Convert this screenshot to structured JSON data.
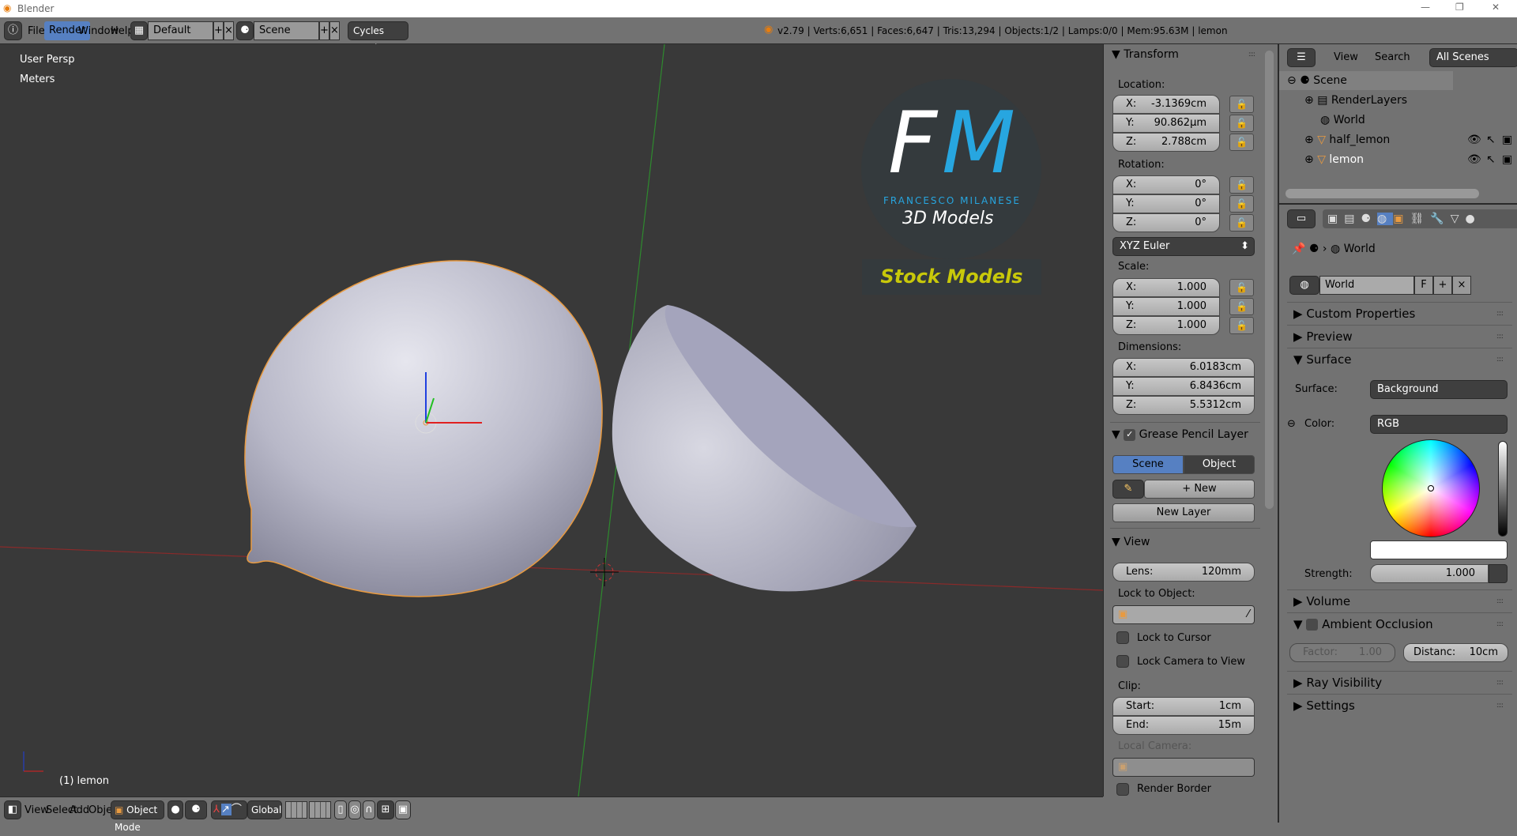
{
  "window": {
    "title": "Blender",
    "min": "—",
    "max": "❐",
    "close": "✕"
  },
  "topbar": {
    "menus": [
      "File",
      "Render",
      "Window",
      "Help"
    ],
    "layout": "Default",
    "scene": "Scene",
    "engine": "Cycles Render",
    "info": "v2.79 | Verts:6,651 | Faces:6,647 | Tris:13,294 | Objects:1/2 | Lamps:0/0 | Mem:95.63M | lemon"
  },
  "viewport": {
    "view_name": "User Persp",
    "units": "Meters",
    "object_label": "(1) lemon",
    "logo": {
      "letters_f": "F",
      "letters_m": "M",
      "brand": "FRANCESCO MILANESE",
      "sub": "3D Models",
      "badge": "Stock Models"
    }
  },
  "npanel": {
    "transform": {
      "title": "Transform",
      "location_label": "Location:",
      "location": [
        {
          "axis": "X:",
          "value": "-3.1369cm"
        },
        {
          "axis": "Y:",
          "value": "90.862µm"
        },
        {
          "axis": "Z:",
          "value": "2.788cm"
        }
      ],
      "rotation_label": "Rotation:",
      "rotation": [
        {
          "axis": "X:",
          "value": "0°"
        },
        {
          "axis": "Y:",
          "value": "0°"
        },
        {
          "axis": "Z:",
          "value": "0°"
        }
      ],
      "rotation_mode": "XYZ Euler",
      "scale_label": "Scale:",
      "scale": [
        {
          "axis": "X:",
          "value": "1.000"
        },
        {
          "axis": "Y:",
          "value": "1.000"
        },
        {
          "axis": "Z:",
          "value": "1.000"
        }
      ],
      "dimensions_label": "Dimensions:",
      "dimensions": [
        {
          "axis": "X:",
          "value": "6.0183cm"
        },
        {
          "axis": "Y:",
          "value": "6.8436cm"
        },
        {
          "axis": "Z:",
          "value": "5.5312cm"
        }
      ]
    },
    "grease": {
      "title": "Grease Pencil Layer",
      "scene": "Scene",
      "object": "Object",
      "new": "New",
      "new_layer": "New Layer"
    },
    "view": {
      "title": "View",
      "lens_label": "Lens:",
      "lens": "120mm",
      "lock_object": "Lock to Object:",
      "lock_cursor": "Lock to Cursor",
      "lock_camera": "Lock Camera to View",
      "clip": "Clip:",
      "start_label": "Start:",
      "start": "1cm",
      "end_label": "End:",
      "end": "15m",
      "local_camera": "Local Camera:",
      "render_border": "Render Border"
    }
  },
  "outliner": {
    "view": "View",
    "search": "Search",
    "filter": "All Scenes",
    "items": [
      "Scene",
      "RenderLayers",
      "World",
      "half_lemon",
      "lemon"
    ]
  },
  "properties": {
    "breadcrumb": "World",
    "world_name": "World",
    "fake_user": "F",
    "sections": {
      "custom": "Custom Properties",
      "preview": "Preview",
      "surface": "Surface",
      "volume": "Volume",
      "ao": "Ambient Occlusion",
      "ray": "Ray Visibility",
      "settings": "Settings"
    },
    "surface_label": "Surface:",
    "surface_value": "Background",
    "color_label": "Color:",
    "color_mode": "RGB",
    "color_value": "#ffffff",
    "strength_label": "Strength:",
    "strength": "1.000",
    "factor_label": "Factor:",
    "factor": "1.00",
    "distance_label": "Distanc:",
    "distance": "10cm"
  },
  "bottombar": {
    "menus": [
      "View",
      "Select",
      "Add",
      "Object"
    ],
    "mode": "Object Mode",
    "orientation": "Global"
  },
  "colors": {
    "accent": "#5680c2",
    "viewport": "#393939",
    "panel": "#727272",
    "logo_blue": "#27a6e0",
    "badge": "#c8c80a"
  }
}
